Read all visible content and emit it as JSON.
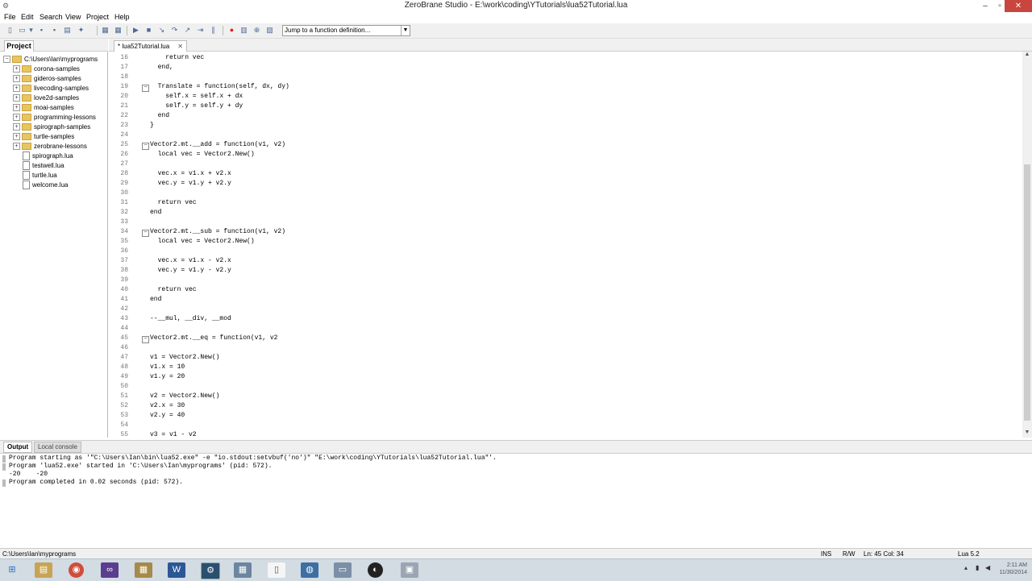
{
  "window": {
    "title": "ZeroBrane Studio - E:\\work\\coding\\YTutorials\\lua52Tutorial.lua",
    "controls": [
      "–",
      "▫",
      "✕"
    ]
  },
  "menu": [
    "File",
    "Edit",
    "Search",
    "View",
    "Project",
    "Help"
  ],
  "toolbar": {
    "icons": [
      "new-file-icon",
      "open-file-icon",
      "save-icon",
      "save-all-icon",
      "project-directory-icon",
      "dropdown-icon",
      "find-icon",
      "replace-icon",
      "run-icon",
      "stop-icon",
      "step-into-icon",
      "step-over-icon",
      "step-out-icon",
      "toggle-breakpoint-icon",
      "break-icon",
      "stack-window-icon",
      "watch-window-icon"
    ],
    "jump_placeholder": "Jump to a function definition..."
  },
  "project_panel": {
    "tab_label": "Project",
    "root": "C:\\Users\\Ian\\myprograms",
    "folders": [
      "corona-samples",
      "gideros-samples",
      "livecoding-samples",
      "love2d-samples",
      "moai-samples",
      "programming-lessons",
      "spirograph-samples",
      "turtle-samples",
      "zerobrane-lessons"
    ],
    "files": [
      "spirograph.lua",
      "testwell.lua",
      "turtle.lua",
      "welcome.lua"
    ]
  },
  "editor": {
    "tab_label": "* lua52Tutorial.lua",
    "tab_close": "✕",
    "lines": [
      {
        "n": "16",
        "code": "    return vec"
      },
      {
        "n": "17",
        "code": "  end,"
      },
      {
        "n": "18",
        "code": ""
      },
      {
        "n": "19",
        "code": "  Translate = function(self, dx, dy)",
        "fold": true
      },
      {
        "n": "20",
        "code": "    self.x = self.x + dx"
      },
      {
        "n": "21",
        "code": "    self.y = self.y + dy"
      },
      {
        "n": "22",
        "code": "  end"
      },
      {
        "n": "23",
        "code": "}"
      },
      {
        "n": "24",
        "code": ""
      },
      {
        "n": "25",
        "code": "Vector2.mt.__add = function(v1, v2)",
        "fold": true
      },
      {
        "n": "26",
        "code": "  local vec = Vector2.New()"
      },
      {
        "n": "27",
        "code": ""
      },
      {
        "n": "28",
        "code": "  vec.x = v1.x + v2.x"
      },
      {
        "n": "29",
        "code": "  vec.y = v1.y + v2.y"
      },
      {
        "n": "30",
        "code": ""
      },
      {
        "n": "31",
        "code": "  return vec"
      },
      {
        "n": "32",
        "code": "end"
      },
      {
        "n": "33",
        "code": ""
      },
      {
        "n": "34",
        "code": "Vector2.mt.__sub = function(v1, v2)",
        "fold": true
      },
      {
        "n": "35",
        "code": "  local vec = Vector2.New()"
      },
      {
        "n": "36",
        "code": ""
      },
      {
        "n": "37",
        "code": "  vec.x = v1.x - v2.x"
      },
      {
        "n": "38",
        "code": "  vec.y = v1.y - v2.y"
      },
      {
        "n": "39",
        "code": ""
      },
      {
        "n": "40",
        "code": "  return vec"
      },
      {
        "n": "41",
        "code": "end"
      },
      {
        "n": "42",
        "code": ""
      },
      {
        "n": "43",
        "code": "--__mul, __div, __mod"
      },
      {
        "n": "44",
        "code": ""
      },
      {
        "n": "45",
        "code": "Vector2.mt.__eq = function(v1, v2",
        "fold": true
      },
      {
        "n": "46",
        "code": ""
      },
      {
        "n": "47",
        "code": "v1 = Vector2.New()"
      },
      {
        "n": "48",
        "code": "v1.x = 10"
      },
      {
        "n": "49",
        "code": "v1.y = 20"
      },
      {
        "n": "50",
        "code": ""
      },
      {
        "n": "51",
        "code": "v2 = Vector2.New()"
      },
      {
        "n": "52",
        "code": "v2.x = 30"
      },
      {
        "n": "53",
        "code": "v2.y = 40"
      },
      {
        "n": "54",
        "code": ""
      },
      {
        "n": "55",
        "code": "v3 = v1 - v2"
      }
    ]
  },
  "output_panel": {
    "tabs": [
      "Output",
      "Local console"
    ],
    "lines": [
      "Program starting as '\"C:\\Users\\Ian\\bin\\lua52.exe\" -e \"io.stdout:setvbuf('no')\" \"E:\\work\\coding\\YTutorials\\lua52Tutorial.lua\"'.",
      "Program 'lua52.exe' started in 'C:\\Users\\Ian\\myprograms' (pid: 572).",
      "-20    -20",
      "Program completed in 0.02 seconds (pid: 572)."
    ]
  },
  "statusbar": {
    "path": "C:\\Users\\Ian\\myprograms",
    "ins": "INS",
    "rw": "R/W",
    "position": "Ln: 45 Col: 34",
    "interpreter": "Lua 5.2"
  },
  "taskbar": {
    "apps": [
      "windows-start-icon",
      "file-explorer-icon",
      "chrome-icon",
      "visual-studio-icon",
      "file-manager-icon",
      "word-icon",
      "zerobrane-icon",
      "calculator-icon",
      "notepad-icon",
      "network-icon",
      "folder-icon",
      "obs-icon",
      "app-icon"
    ],
    "clock_time": "2:11 AM",
    "clock_date": "11/30/2014"
  }
}
